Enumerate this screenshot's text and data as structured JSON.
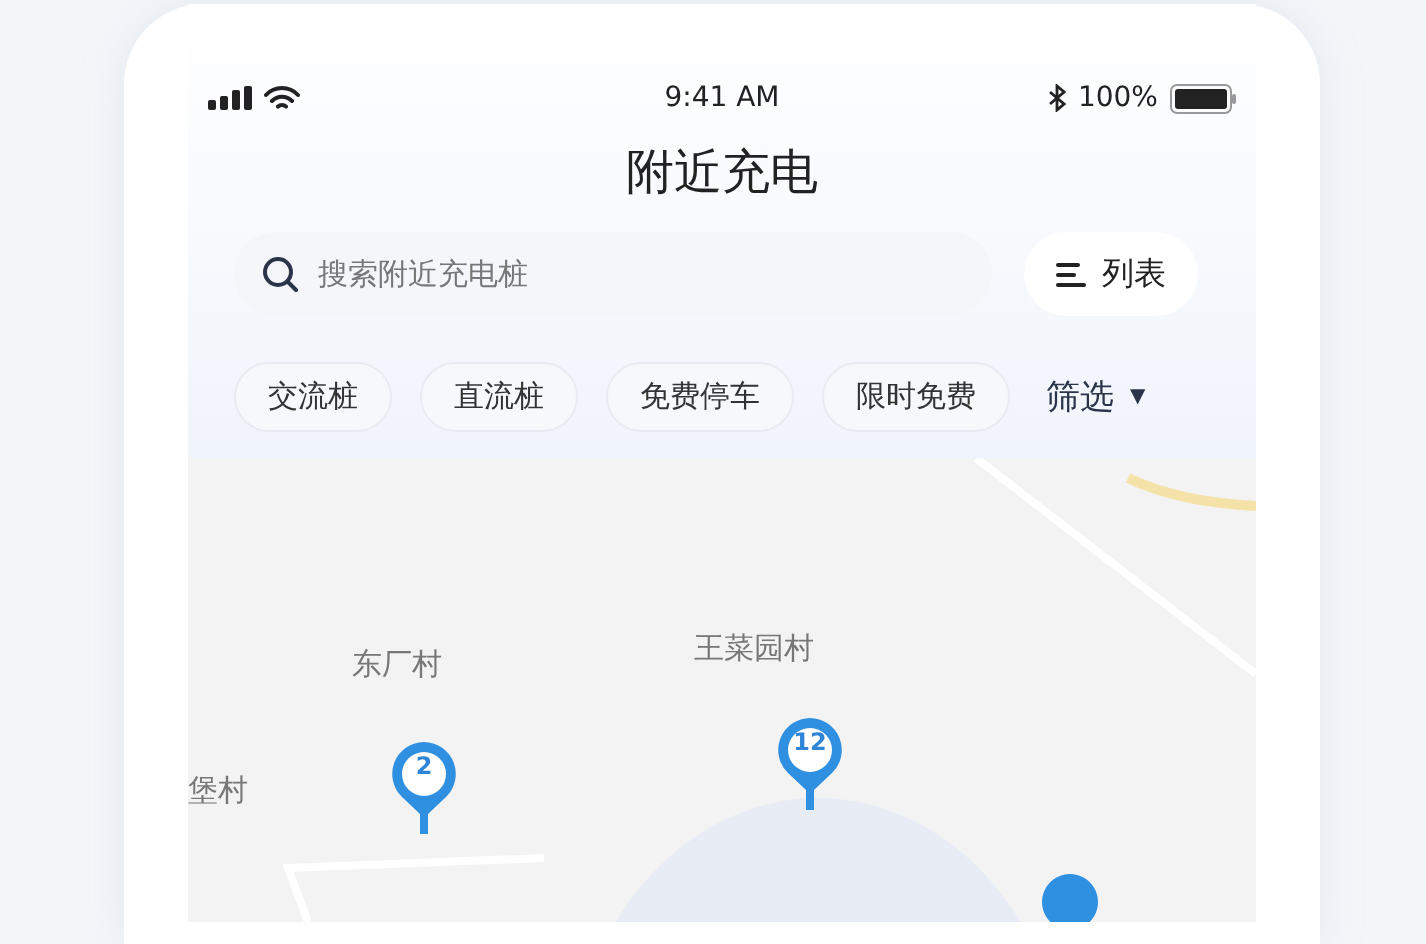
{
  "status_bar": {
    "time": "9:41 AM",
    "battery": "100%"
  },
  "title": "附近充电",
  "search": {
    "placeholder": "搜索附近充电桩"
  },
  "list_button": {
    "label": "列表"
  },
  "filters": [
    {
      "label": "交流桩",
      "selected": false
    },
    {
      "label": "直流桩",
      "selected": false
    },
    {
      "label": "免费停车",
      "selected": false
    },
    {
      "label": "限时免费",
      "selected": false
    }
  ],
  "filter_button": {
    "label": "筛选",
    "icon": "▼"
  },
  "map": {
    "places": [
      {
        "name": "东厂村"
      },
      {
        "name": "王菜园村"
      },
      {
        "name": "堡村"
      }
    ],
    "clusters": [
      {
        "count": "2"
      },
      {
        "count": "12"
      }
    ]
  }
}
